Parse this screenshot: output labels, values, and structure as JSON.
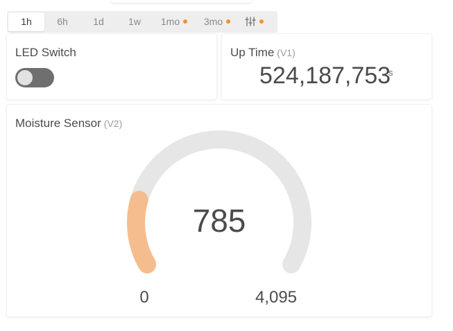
{
  "time_ranges": [
    {
      "label": "1h",
      "active": true,
      "dot": false
    },
    {
      "label": "6h",
      "active": false,
      "dot": false
    },
    {
      "label": "1d",
      "active": false,
      "dot": false
    },
    {
      "label": "1w",
      "active": false,
      "dot": false
    },
    {
      "label": "1mo",
      "active": false,
      "dot": true
    },
    {
      "label": "3mo",
      "active": false,
      "dot": true
    }
  ],
  "settings_icon": "sliders-icon",
  "settings_dot": true,
  "accent_color": "#f0922e",
  "gauge_fill_color": "#f5bd8e",
  "gauge_track_color": "#e6e6e6",
  "led_switch": {
    "title": "LED Switch",
    "state": "off"
  },
  "up_time": {
    "title": "Up Time",
    "pin": "(V1)",
    "value": "524,187,753",
    "unit": "s"
  },
  "moisture_sensor": {
    "title": "Moisture Sensor",
    "pin": "(V2)",
    "value": 785,
    "value_label": "785",
    "min": 0,
    "max": 4095,
    "min_label": "0",
    "max_label": "4,095"
  }
}
